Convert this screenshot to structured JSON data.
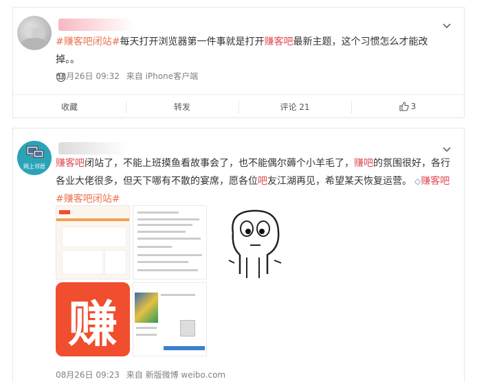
{
  "post1": {
    "text_topic1": "#赚客吧闭站#",
    "text_body1": "每天打开浏览器第一件事就是打开",
    "text_hl": "赚客吧",
    "text_body2": "最新主题，这个习惯怎么才能改掉。。",
    "emoji": "😓",
    "date": "08月26日 09:32",
    "source": "来自 iPhone客户端",
    "actions": {
      "favorite": "收藏",
      "repost": "转发",
      "comment": "评论 21",
      "like_count": "3"
    }
  },
  "post2": {
    "avatar_text": "网上邻居",
    "text_hl1": "赚客吧",
    "text_body1": "闭站了，不能上班摸鱼看故事会了，也不能偶尔薅个小羊毛了，",
    "text_hl2": "赚吧",
    "text_body2": "的氛围很好，各行各业大佬很多，但天下哪有不散的宴席，愿各位",
    "text_hl3": "吧",
    "text_body3": "友江湖再见，希望某天恢复运营。",
    "text_topic_icon": "◇",
    "text_topic_a": "赚客吧",
    "text_topic_b": "#赚客吧闭站#",
    "logo_char": "赚",
    "date": "08月26日 09:23",
    "source": "来自 新版微博 weibo.com"
  },
  "colors": {
    "topic": "#eb7350",
    "highlight": "#e04a52",
    "logo_bg": "#f04e2e"
  },
  "icons": [
    "chevron-down-icon",
    "thumb-up-icon",
    "diamond-icon"
  ]
}
